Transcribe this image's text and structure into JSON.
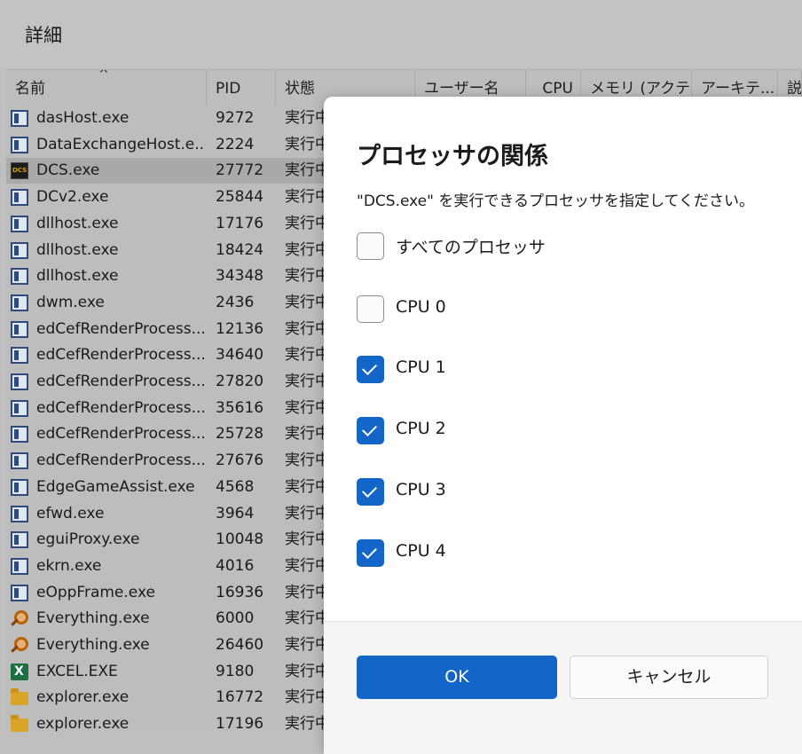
{
  "header": {
    "title": "詳細"
  },
  "columns": [
    "名前",
    "PID",
    "状態",
    "ユーザー名",
    "CPU",
    "メモリ (アクテ...",
    "アーキテ...",
    "説"
  ],
  "processes": [
    {
      "name": "dasHost.exe",
      "pid": "9272",
      "status": "実行中",
      "icon": "window-icon"
    },
    {
      "name": "DataExchangeHost.e...",
      "pid": "2224",
      "status": "実行中",
      "icon": "window-icon"
    },
    {
      "name": "DCS.exe",
      "pid": "27772",
      "status": "実行中",
      "icon": "dcs-icon"
    },
    {
      "name": "DCv2.exe",
      "pid": "25844",
      "status": "実行中",
      "icon": "window-icon"
    },
    {
      "name": "dllhost.exe",
      "pid": "17176",
      "status": "実行中",
      "icon": "window-icon"
    },
    {
      "name": "dllhost.exe",
      "pid": "18424",
      "status": "実行中",
      "icon": "window-icon"
    },
    {
      "name": "dllhost.exe",
      "pid": "34348",
      "status": "実行中",
      "icon": "window-icon"
    },
    {
      "name": "dwm.exe",
      "pid": "2436",
      "status": "実行中",
      "icon": "window-icon"
    },
    {
      "name": "edCefRenderProcess....",
      "pid": "12136",
      "status": "実行中",
      "icon": "window-icon"
    },
    {
      "name": "edCefRenderProcess....",
      "pid": "34640",
      "status": "実行中",
      "icon": "window-icon"
    },
    {
      "name": "edCefRenderProcess....",
      "pid": "27820",
      "status": "実行中",
      "icon": "window-icon"
    },
    {
      "name": "edCefRenderProcess....",
      "pid": "35616",
      "status": "実行中",
      "icon": "window-icon"
    },
    {
      "name": "edCefRenderProcess....",
      "pid": "25728",
      "status": "実行中",
      "icon": "window-icon"
    },
    {
      "name": "edCefRenderProcess....",
      "pid": "27676",
      "status": "実行中",
      "icon": "window-icon"
    },
    {
      "name": "EdgeGameAssist.exe",
      "pid": "4568",
      "status": "実行中",
      "icon": "window-icon"
    },
    {
      "name": "efwd.exe",
      "pid": "3964",
      "status": "実行中",
      "icon": "window-icon"
    },
    {
      "name": "eguiProxy.exe",
      "pid": "10048",
      "status": "実行中",
      "icon": "window-icon"
    },
    {
      "name": "ekrn.exe",
      "pid": "4016",
      "status": "実行中",
      "icon": "window-icon"
    },
    {
      "name": "eOppFrame.exe",
      "pid": "16936",
      "status": "実行中",
      "icon": "window-icon"
    },
    {
      "name": "Everything.exe",
      "pid": "6000",
      "status": "実行中",
      "icon": "search-icon"
    },
    {
      "name": "Everything.exe",
      "pid": "26460",
      "status": "実行中",
      "icon": "search-icon"
    },
    {
      "name": "EXCEL.EXE",
      "pid": "9180",
      "status": "実行中",
      "icon": "excel-icon"
    },
    {
      "name": "explorer.exe",
      "pid": "16772",
      "status": "実行中",
      "icon": "folder-icon"
    },
    {
      "name": "explorer.exe",
      "pid": "17196",
      "status": "実行中",
      "icon": "folder-icon"
    }
  ],
  "selected_process": "DCS.exe",
  "dialog": {
    "title": "プロセッサの関係",
    "description": "\"DCS.exe\" を実行できるプロセッサを指定してください。",
    "options": [
      {
        "label": "すべてのプロセッサ",
        "checked": false
      },
      {
        "label": "CPU 0",
        "checked": false
      },
      {
        "label": "CPU 1",
        "checked": true
      },
      {
        "label": "CPU 2",
        "checked": true
      },
      {
        "label": "CPU 3",
        "checked": true
      },
      {
        "label": "CPU 4",
        "checked": true
      }
    ],
    "ok_label": "OK",
    "cancel_label": "キャンセル"
  },
  "colors": {
    "accent": "#1366c8",
    "overlay": "#bfbfbf",
    "dialog_bg": "#ffffff"
  }
}
